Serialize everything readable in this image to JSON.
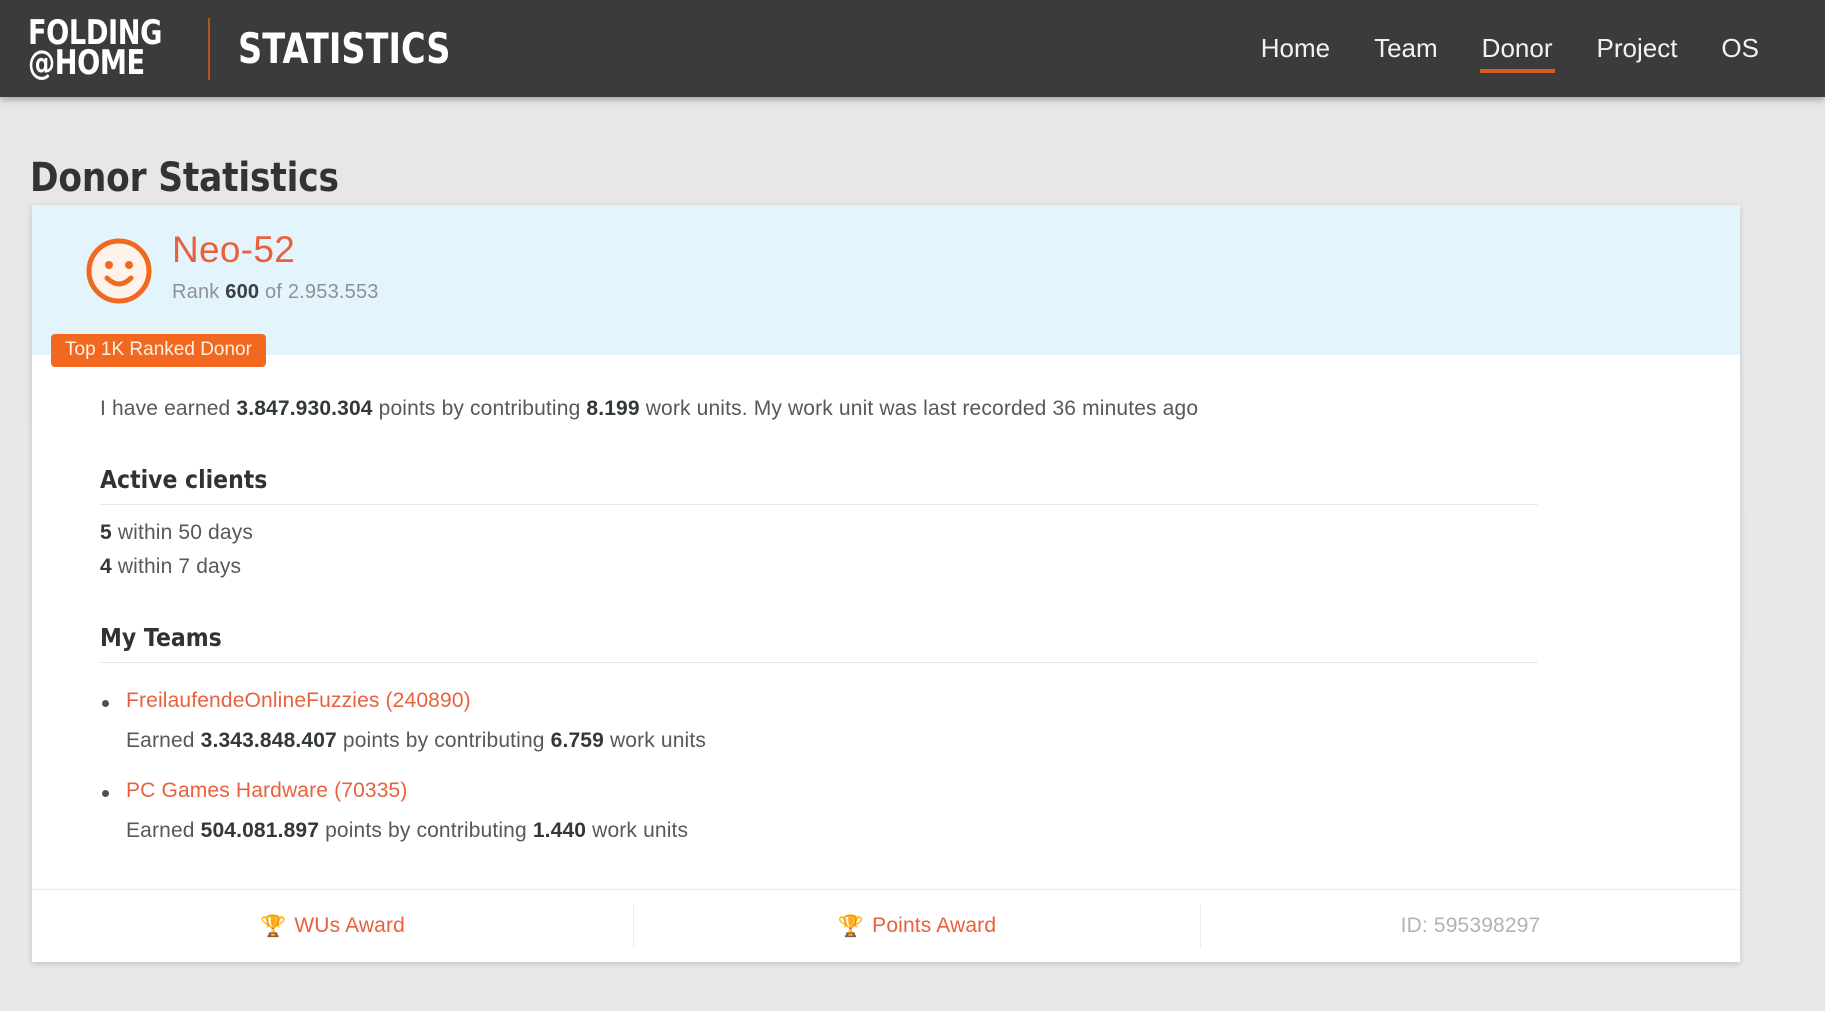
{
  "header": {
    "logo_line1": "FOLDING",
    "logo_line2": "@HOME",
    "title": "STATISTICS",
    "nav": [
      {
        "label": "Home",
        "active": false
      },
      {
        "label": "Team",
        "active": false
      },
      {
        "label": "Donor",
        "active": true
      },
      {
        "label": "Project",
        "active": false
      },
      {
        "label": "OS",
        "active": false
      }
    ]
  },
  "page": {
    "title": "Donor Statistics"
  },
  "donor": {
    "name": "Neo-52",
    "rank_prefix": "Rank",
    "rank": "600",
    "rank_suffix": "of 2.953.553",
    "badge": "Top 1K Ranked Donor",
    "summary": {
      "lead": "I have earned",
      "points": "3.847.930.304",
      "mid": "points by contributing",
      "work_units": "8.199",
      "tail": "work units. My work unit was last recorded 36 minutes ago"
    }
  },
  "active_clients": {
    "title": "Active clients",
    "rows": [
      {
        "count": "5",
        "label": "within 50 days"
      },
      {
        "count": "4",
        "label": "within 7 days"
      }
    ]
  },
  "my_teams": {
    "title": "My Teams",
    "teams": [
      {
        "link": "FreilaufendeOnlineFuzzies (240890)",
        "earned_prefix": "Earned",
        "points": "3.343.848.407",
        "earned_mid": "points by contributing",
        "work_units": "6.759",
        "earned_suffix": "work units"
      },
      {
        "link": "PC Games Hardware (70335)",
        "earned_prefix": "Earned",
        "points": "504.081.897",
        "earned_mid": "points by contributing",
        "work_units": "1.440",
        "earned_suffix": "work units"
      }
    ]
  },
  "footer": {
    "wus_award": "WUs Award",
    "points_award": "Points Award",
    "id": "ID: 595398297",
    "trophy_icon": "trophy-icon"
  },
  "colors": {
    "accent": "#f2681f",
    "link": "#e8613c",
    "header_bg": "#3b3b3b",
    "card_header_bg": "#e4f4fd",
    "page_bg": "#e8e8e8"
  }
}
